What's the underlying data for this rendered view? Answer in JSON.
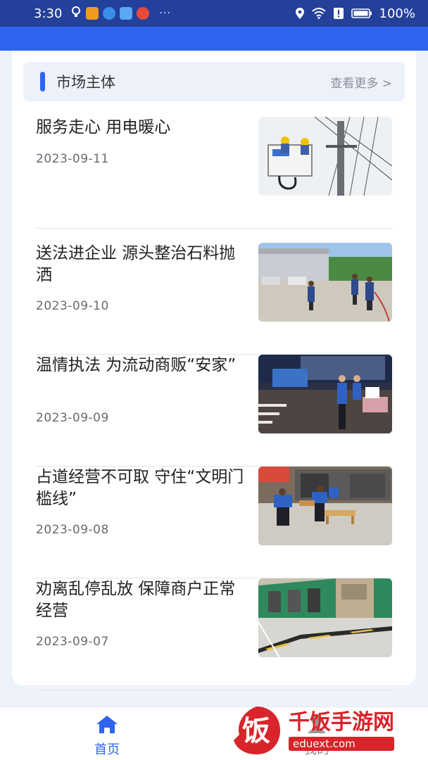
{
  "status_bar": {
    "time": "3:30",
    "dots": "···",
    "battery": "100%",
    "icons": [
      "bulb-icon",
      "video-app-icon",
      "browser-app-icon",
      "cloud-app-icon",
      "weibo-app-icon",
      "location-icon",
      "wifi-icon",
      "alert-icon",
      "battery-icon"
    ]
  },
  "colors": {
    "status_bar": "#23409a",
    "header": "#2e64ee",
    "accent": "#2e64ee",
    "background": "#eef2fb"
  },
  "section": {
    "title": "市场主体",
    "more": "查看更多 >"
  },
  "news": [
    {
      "title": "服务走心 用电暖心",
      "date": "2023-09-11",
      "thumb": "utility-workers-photo"
    },
    {
      "title": "送法进企业 源头整治石料抛洒",
      "date": "2023-09-10",
      "thumb": "officers-at-warehouse-photo"
    },
    {
      "title": "温情执法 为流动商贩“安家”",
      "date": "2023-09-09",
      "thumb": "night-street-vendor-photo"
    },
    {
      "title": "占道经营不可取 守住“文明门槛线”",
      "date": "2023-09-08",
      "thumb": "street-cleanup-photo"
    },
    {
      "title": "劝离乱停乱放 保障商户正常经营",
      "date": "2023-09-07",
      "thumb": "storefront-street-photo"
    }
  ],
  "bottom_nav": {
    "home": "首页",
    "mine": "我的"
  },
  "watermark": {
    "logo_char": "饭",
    "name": "千饭手游网",
    "url": "eduext.com"
  }
}
